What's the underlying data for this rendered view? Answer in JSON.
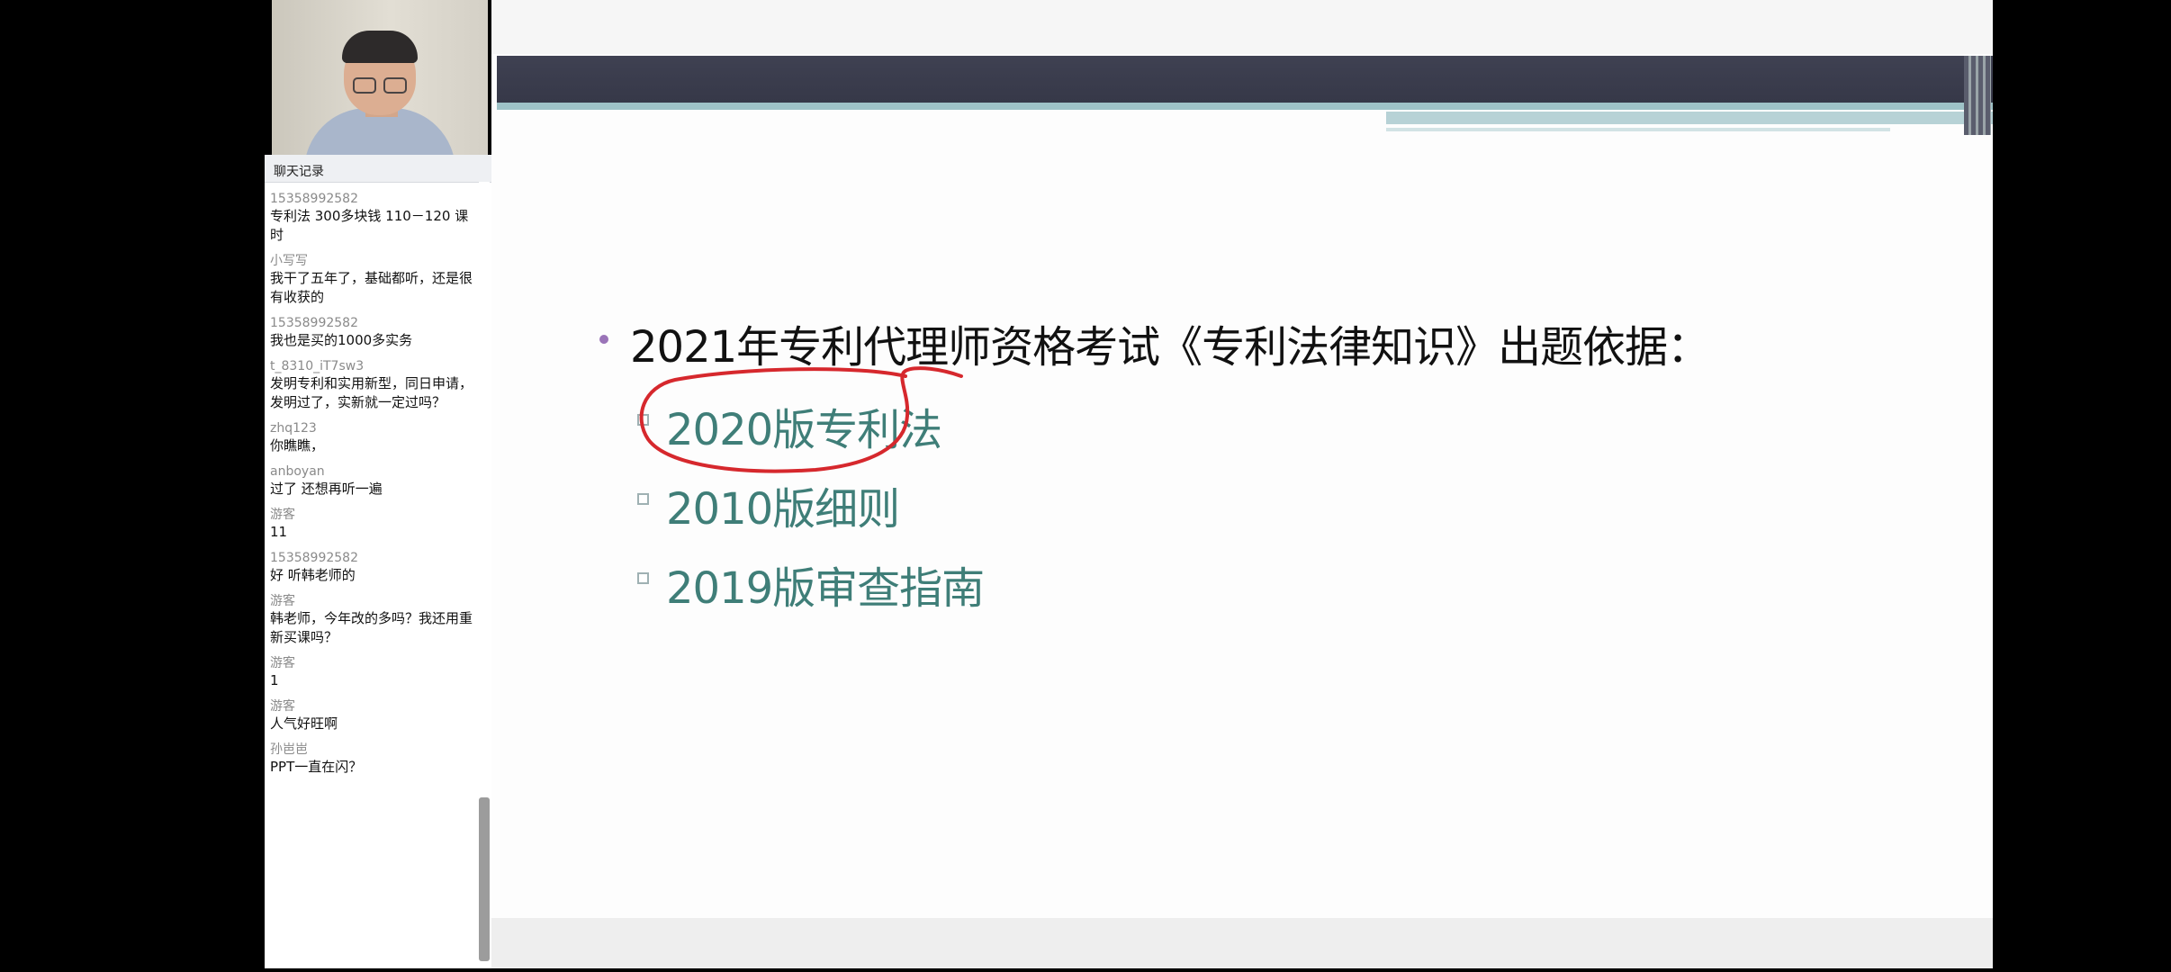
{
  "chat": {
    "title": "聊天记录",
    "messages": [
      {
        "user": "15358992582",
        "text": "专利法 300多块钱 110－120 课时"
      },
      {
        "user": "小写写",
        "text": "我干了五年了，基础都听，还是很有收获的"
      },
      {
        "user": "15358992582",
        "text": "我也是买的1000多实务"
      },
      {
        "user": "t_8310_iT7sw3",
        "text": "发明专利和实用新型，同日申请，发明过了，实新就一定过吗？"
      },
      {
        "user": "zhq123",
        "text": "你瞧瞧，"
      },
      {
        "user": "anboyan",
        "text": "过了 还想再听一遍"
      },
      {
        "user": "游客",
        "text": "11"
      },
      {
        "user": "15358992582",
        "text": "好 听韩老师的"
      },
      {
        "user": "游客",
        "text": "韩老师，今年改的多吗？我还用重新买课吗？"
      },
      {
        "user": "游客",
        "text": "1"
      },
      {
        "user": "游客",
        "text": "人气好旺啊"
      },
      {
        "user": "孙岜岜",
        "text": "PPT一直在闪？"
      }
    ]
  },
  "slide": {
    "main_bullet": "2021年专利代理师资格考试《专利法律知识》出题依据：",
    "sub_items": [
      "2020版专利法",
      "2010版细则",
      "2019版审查指南"
    ],
    "colors": {
      "header_bar": "#3f4152",
      "accent_line": "#9ec2c7",
      "bullet_dot": "#9a74b8",
      "sub_text": "#3f7e78",
      "annotation": "#d6282d"
    }
  }
}
